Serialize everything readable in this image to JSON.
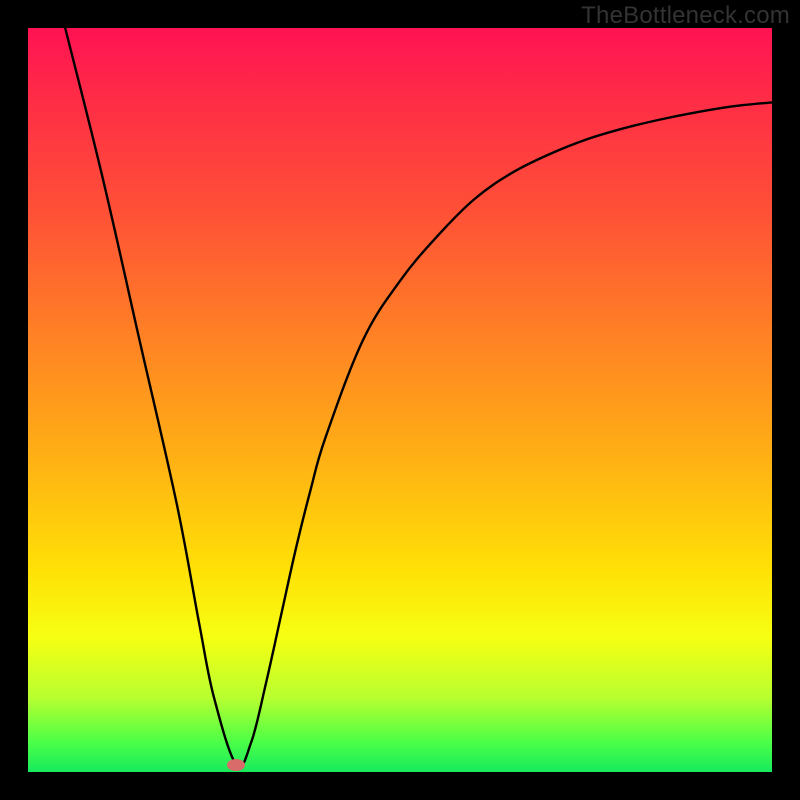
{
  "attribution": "TheBottleneck.com",
  "colors": {
    "frame_bg": "#000000",
    "curve_stroke": "#000000",
    "marker_fill": "#d96b6b",
    "gradient_stops": [
      "#ff1253",
      "#ff2b47",
      "#ff5136",
      "#ff8324",
      "#ffb114",
      "#ffe106",
      "#f6ff13",
      "#b8ff2f",
      "#4bff47",
      "#17e95d"
    ]
  },
  "chart_data": {
    "type": "line",
    "title": "",
    "xlabel": "",
    "ylabel": "",
    "xlim": [
      0,
      100
    ],
    "ylim": [
      0,
      100
    ],
    "grid": false,
    "legend": false,
    "series": [
      {
        "name": "curve",
        "x": [
          5,
          10,
          15,
          20,
          23,
          25,
          28,
          30,
          32,
          34,
          36,
          38,
          40,
          45,
          50,
          55,
          60,
          65,
          70,
          75,
          80,
          85,
          90,
          95,
          100
        ],
        "values": [
          100,
          80,
          58,
          36,
          20,
          10,
          1,
          4,
          12,
          21,
          30,
          38,
          45,
          58,
          66,
          72,
          77,
          80.5,
          83,
          85,
          86.5,
          87.7,
          88.7,
          89.5,
          90
        ]
      }
    ],
    "marker": {
      "x": 28,
      "y": 1
    }
  }
}
